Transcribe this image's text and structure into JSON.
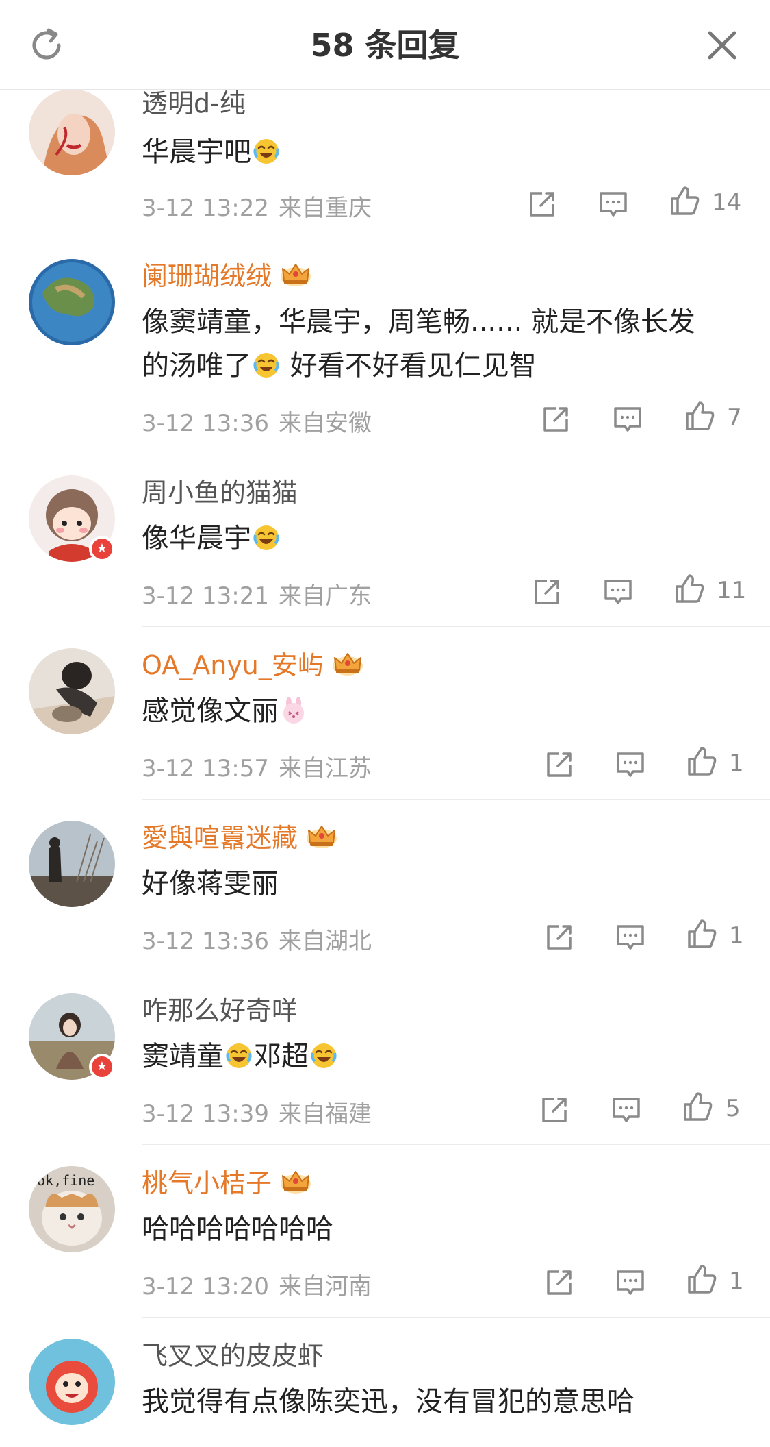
{
  "header": {
    "title": "58 条回复",
    "refresh_icon": "refresh-icon",
    "close_icon": "close-icon"
  },
  "colors": {
    "vip_name": "#e5792a",
    "normal_name": "#555555",
    "meta": "#a0a0a0",
    "verified_badge": "#e8423b"
  },
  "comments": [
    {
      "user": "透明d-纯",
      "vip": false,
      "text_parts": [
        "华晨宇吧",
        "[laugh-cry-emoji]"
      ],
      "time": "3-12 13:22",
      "location": "来自重庆",
      "likes": "14"
    },
    {
      "user": "阑珊瑚绒绒",
      "vip": true,
      "text_line1": "像窦靖童，华晨宇，周笔畅...... 就是不像长发",
      "text_line2a": "的汤唯了",
      "text_line2b": "好看不好看见仁见智",
      "time": "3-12 13:36",
      "location": "来自安徽",
      "likes": "7"
    },
    {
      "user": "周小鱼的猫猫",
      "vip": false,
      "verified": true,
      "text": "像华晨宇",
      "time": "3-12 13:21",
      "location": "来自广东",
      "likes": "11"
    },
    {
      "user": "OA_Anyu_安屿",
      "vip": true,
      "text": "感觉像文丽",
      "time": "3-12 13:57",
      "location": "来自江苏",
      "likes": "1"
    },
    {
      "user": "愛與喧囂迷藏",
      "vip": true,
      "text": "好像蒋雯丽",
      "time": "3-12 13:36",
      "location": "来自湖北",
      "likes": "1"
    },
    {
      "user": "咋那么好奇咩",
      "vip": false,
      "verified": true,
      "text_a": "窦靖童",
      "text_b": "邓超",
      "time": "3-12 13:39",
      "location": "来自福建",
      "likes": "5"
    },
    {
      "user": "桃气小桔子",
      "vip": true,
      "avatar_text": "ok,fine",
      "text": "哈哈哈哈哈哈哈",
      "time": "3-12 13:20",
      "location": "来自河南",
      "likes": "1"
    },
    {
      "user": "飞叉叉的皮皮虾",
      "vip": false,
      "text": "我觉得有点像陈奕迅，没有冒犯的意思哈"
    }
  ]
}
